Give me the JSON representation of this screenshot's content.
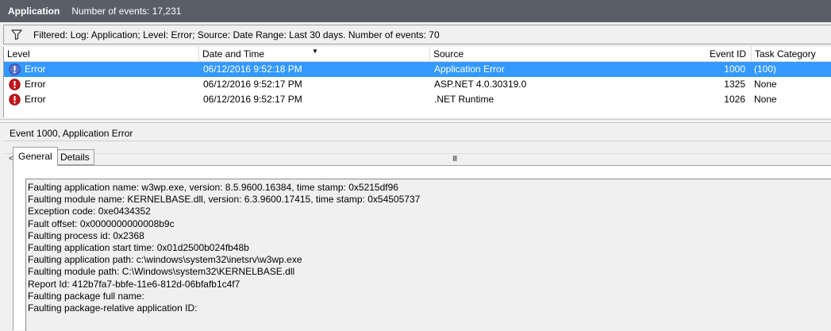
{
  "header": {
    "title": "Application",
    "event_count": "Number of events: 17,231"
  },
  "filter": {
    "icon": "funnel-icon",
    "text": "Filtered: Log: Application; Level: Error; Source: Date Range: Last 30 days. Number of events: 70"
  },
  "grid": {
    "columns": {
      "level": "Level",
      "date": "Date and Time",
      "source": "Source",
      "event_id": "Event ID",
      "task": "Task Category"
    },
    "sorted_column": "Date and Time",
    "rows": [
      {
        "level": "Error",
        "date": "06/12/2016 9:52:18 PM",
        "source": "Application Error",
        "event_id": "1000",
        "task": "(100)",
        "selected": true
      },
      {
        "level": "Error",
        "date": "06/12/2016 9:52:17 PM",
        "source": "ASP.NET 4.0.30319.0",
        "event_id": "1325",
        "task": "None",
        "selected": false
      },
      {
        "level": "Error",
        "date": "06/12/2016 9:52:17 PM",
        "source": ".NET Runtime",
        "event_id": "1026",
        "task": "None",
        "selected": false
      }
    ],
    "scroll_left_glyph": "<",
    "scroll_thumb_glyph": "III"
  },
  "details": {
    "title": "Event 1000, Application Error",
    "tabs": {
      "general": "General",
      "details": "Details"
    },
    "active_tab": "General",
    "lines": [
      "Faulting application name: w3wp.exe, version: 8.5.9600.16384, time stamp: 0x5215df96",
      "Faulting module name: KERNELBASE.dll, version: 6.3.9600.17415, time stamp: 0x54505737",
      "Exception code: 0xe0434352",
      "Fault offset: 0x0000000000008b9c",
      "Faulting process id: 0x2368",
      "Faulting application start time: 0x01d2500b024fb48b",
      "Faulting application path: c:\\windows\\system32\\inetsrv\\w3wp.exe",
      "Faulting module path: C:\\Windows\\system32\\KERNELBASE.dll",
      "Report Id: 412b7fa7-bbfe-11e6-812d-06bfafb1c4f7",
      "Faulting package full name:",
      "Faulting package-relative application ID:"
    ]
  },
  "colors": {
    "header_bg": "#5a5f66",
    "selection": "#3399ff",
    "error_red": "#c4161c",
    "selected_error_icon": "#5a6fc8"
  }
}
